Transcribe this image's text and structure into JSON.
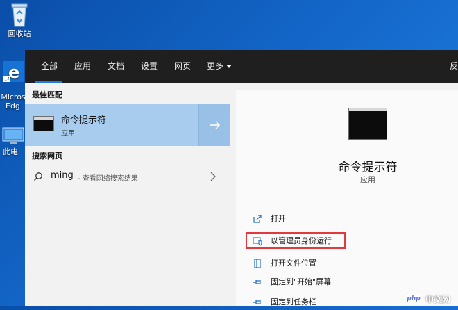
{
  "desktop": {
    "recycle_bin_label": "回收站",
    "edge_label_line1": "Micros",
    "edge_label_line2": "Edg",
    "pc_label": "此电"
  },
  "search": {
    "tabs": [
      {
        "label": "全部"
      },
      {
        "label": "应用"
      },
      {
        "label": "文档"
      },
      {
        "label": "设置"
      },
      {
        "label": "网页"
      },
      {
        "label": "更多"
      }
    ],
    "topbar_right_text": "反",
    "best_match_header": "最佳匹配",
    "best_match": {
      "title": "命令提示符",
      "subtitle": "应用"
    },
    "web_header": "搜索网页",
    "web_result": {
      "query": "ming",
      "suffix": " - 查看网络搜索结果"
    }
  },
  "detail": {
    "title": "命令提示符",
    "subtitle": "应用",
    "actions": [
      {
        "label": "打开",
        "icon": "open-icon"
      },
      {
        "label": "以管理员身份运行",
        "icon": "shield-icon"
      },
      {
        "label": "打开文件位置",
        "icon": "folder-icon"
      },
      {
        "label": "固定到\"开始\"屏幕",
        "icon": "pin-icon"
      },
      {
        "label": "固定到任务栏",
        "icon": "pin-icon"
      }
    ]
  },
  "watermark": {
    "badge": "php",
    "text": "中文网"
  },
  "colors": {
    "accent": "#1e7ae0",
    "selection": "#a8ccee",
    "highlight_box": "#e0393e",
    "topbar": "#1f1f1f"
  }
}
